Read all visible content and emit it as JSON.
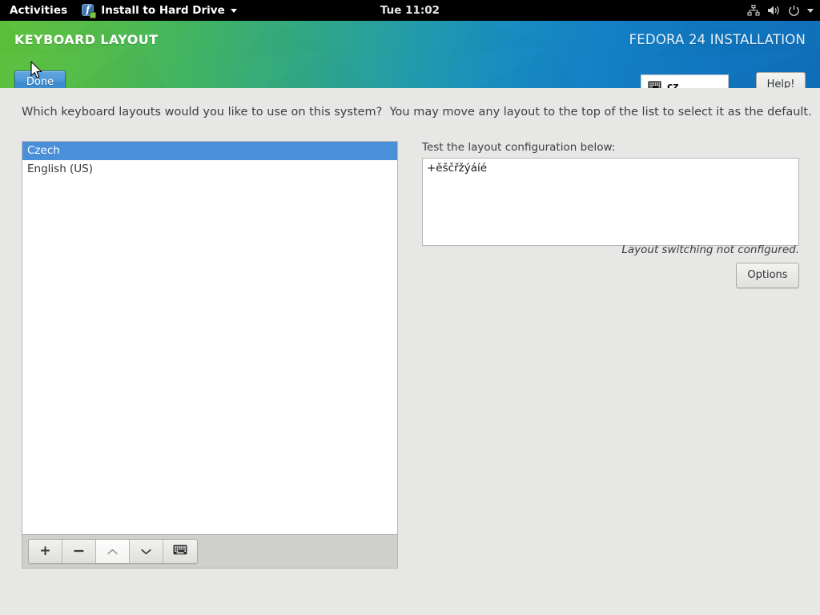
{
  "topbar": {
    "activities": "Activities",
    "app_name": "Install to Hard Drive",
    "app_icon": "fedora-logo-icon",
    "app_menu_caret": "chevron-down-icon",
    "clock": "Tue 11:02",
    "tray_icons": [
      "network-icon",
      "volume-icon",
      "power-icon",
      "chevron-down-icon"
    ]
  },
  "header": {
    "title": "KEYBOARD LAYOUT",
    "product": "FEDORA 24 INSTALLATION",
    "done_label": "Done",
    "help_label": "Help!",
    "layout_indicator": {
      "icon": "keyboard-icon",
      "lang": "cz"
    },
    "gradient_start": "#5bbf38",
    "gradient_end": "#0a6cb8",
    "done_button_color": "#4a96d8"
  },
  "main": {
    "instruction": "Which keyboard layouts would you like to use on this system?  You may move any layout to the top of the list to select it as the default.",
    "layouts": [
      {
        "label": "Czech",
        "selected": true
      },
      {
        "label": "English (US)",
        "selected": false
      }
    ],
    "selection_color": "#4a90d9",
    "toolbar": [
      {
        "name": "add-layout-button",
        "icon": "plus-icon",
        "label": "+",
        "enabled": true,
        "hover": false
      },
      {
        "name": "remove-layout-button",
        "icon": "minus-icon",
        "label": "−",
        "enabled": true,
        "hover": false
      },
      {
        "name": "move-layout-up-button",
        "icon": "chevron-up-icon",
        "label": "",
        "enabled": false,
        "hover": true
      },
      {
        "name": "move-layout-down-button",
        "icon": "chevron-down-icon",
        "label": "",
        "enabled": true,
        "hover": false
      },
      {
        "name": "preview-keyboard-button",
        "icon": "keyboard-icon",
        "label": "",
        "enabled": true,
        "hover": false
      }
    ],
    "test_label": "Test the layout configuration below:",
    "test_value": "+ěščřžýáíé",
    "test_placeholder": "",
    "switch_note": "Layout switching not configured.",
    "options_label": "Options"
  }
}
